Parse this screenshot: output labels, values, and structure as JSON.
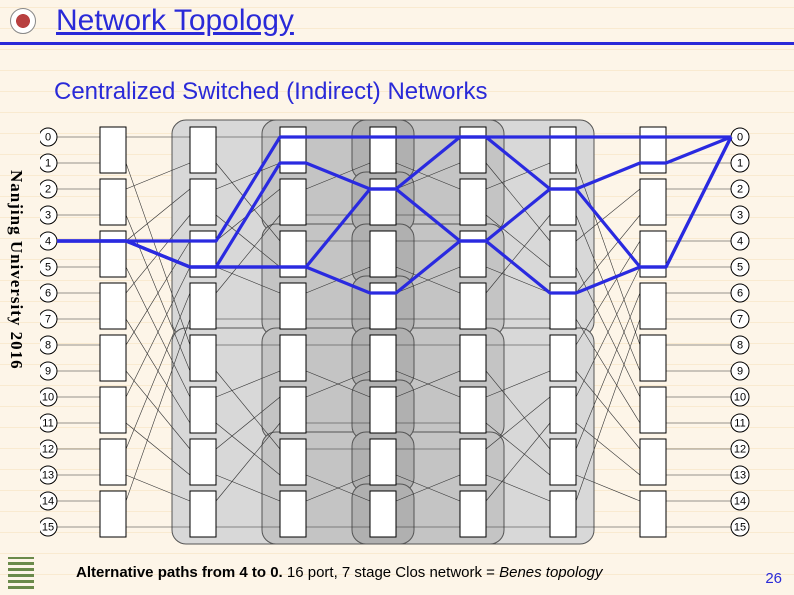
{
  "header": {
    "title": "Network Topology"
  },
  "subtitle": "Centralized Switched (Indirect) Networks",
  "sidebar_text": "Nanjing University 2016",
  "caption_bold": "Alternative paths from 4 to 0.",
  "caption_rest": " 16 port, 7 stage Clos network = ",
  "caption_italic": "Benes topology",
  "page_number": "26",
  "ports_left": [
    "0",
    "1",
    "2",
    "3",
    "4",
    "5",
    "6",
    "7",
    "8",
    "9",
    "10",
    "11",
    "12",
    "13",
    "14",
    "15"
  ],
  "ports_right": [
    "0",
    "1",
    "2",
    "3",
    "4",
    "5",
    "6",
    "7",
    "8",
    "9",
    "10",
    "11",
    "12",
    "13",
    "14",
    "15"
  ],
  "chart_data": {
    "type": "diagram",
    "network": "Benes (7-stage Clos)",
    "ports": 16,
    "stages": 7,
    "switch_radix": 2,
    "switches_per_stage": 8,
    "highlighted_source": 4,
    "highlighted_destination": 0,
    "highlighted_paths": [
      [
        4,
        4,
        0,
        0,
        0,
        0,
        0,
        0
      ],
      [
        4,
        5,
        1,
        2,
        0,
        2,
        1,
        0
      ],
      [
        4,
        5,
        5,
        2,
        4,
        2,
        5,
        1
      ],
      [
        4,
        5,
        5,
        6,
        4,
        6,
        5,
        1
      ]
    ],
    "recursive_boxes": [
      {
        "level": 1,
        "stages": [
          1,
          2,
          3,
          4,
          5
        ],
        "halves": [
          "upper",
          "lower"
        ]
      },
      {
        "level": 2,
        "stages": [
          2,
          3,
          4
        ],
        "halves": [
          "upper",
          "lower"
        ],
        "parent": "each level-1 half"
      },
      {
        "level": 3,
        "stages": [
          3
        ],
        "halves": [
          "upper",
          "lower"
        ],
        "parent": "each level-2 half"
      }
    ]
  }
}
